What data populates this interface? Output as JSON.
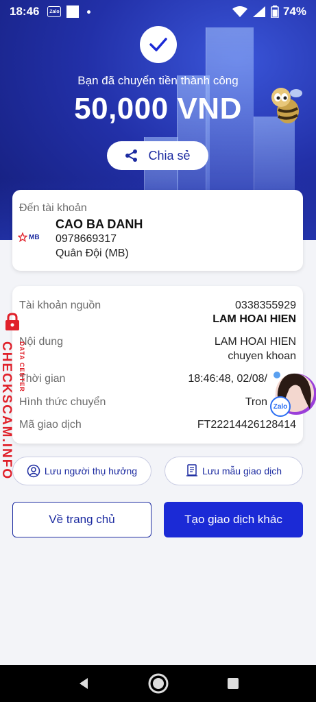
{
  "status_bar": {
    "time": "18:46",
    "notification_app": "Zalo",
    "battery": "74%"
  },
  "hero": {
    "success_text": "Bạn đã chuyển tiền thành công",
    "amount": "50,000 VND",
    "share_label": "Chia sẻ"
  },
  "destination": {
    "label": "Đến tài khoản",
    "bank_logo": "MB",
    "name": "CAO BA DANH",
    "account": "0978669317",
    "bank": "Quân Đội (MB)"
  },
  "details": {
    "source_label": "Tài khoản nguồn",
    "source_account": "0338355929",
    "source_name": "LAM HOAI HIEN",
    "content_label": "Nội dung",
    "content_line1": "LAM HOAI HIEN",
    "content_line2": "chuyen khoan",
    "time_label": "Thời gian",
    "time_value": "18:46:48, 02/08/",
    "method_label": "Hình thức chuyển",
    "method_value": "Tron",
    "txn_label": "Mã giao dịch",
    "txn_value": "FT22214426128414"
  },
  "buttons": {
    "save_beneficiary": "Lưu người thụ hưởng",
    "save_template": "Lưu mẫu giao dịch",
    "home": "Về trang chủ",
    "new_transaction": "Tạo giao dịch khác"
  },
  "watermark": {
    "main": "CHECKSCAM.INFO",
    "sub": "DATA CENTER"
  },
  "floating": {
    "badge": "Zalo"
  },
  "colors": {
    "primary": "#1b2aa0",
    "primary_button": "#1b2ad6",
    "hero_dark": "#141d78",
    "watermark": "#e0202a"
  }
}
